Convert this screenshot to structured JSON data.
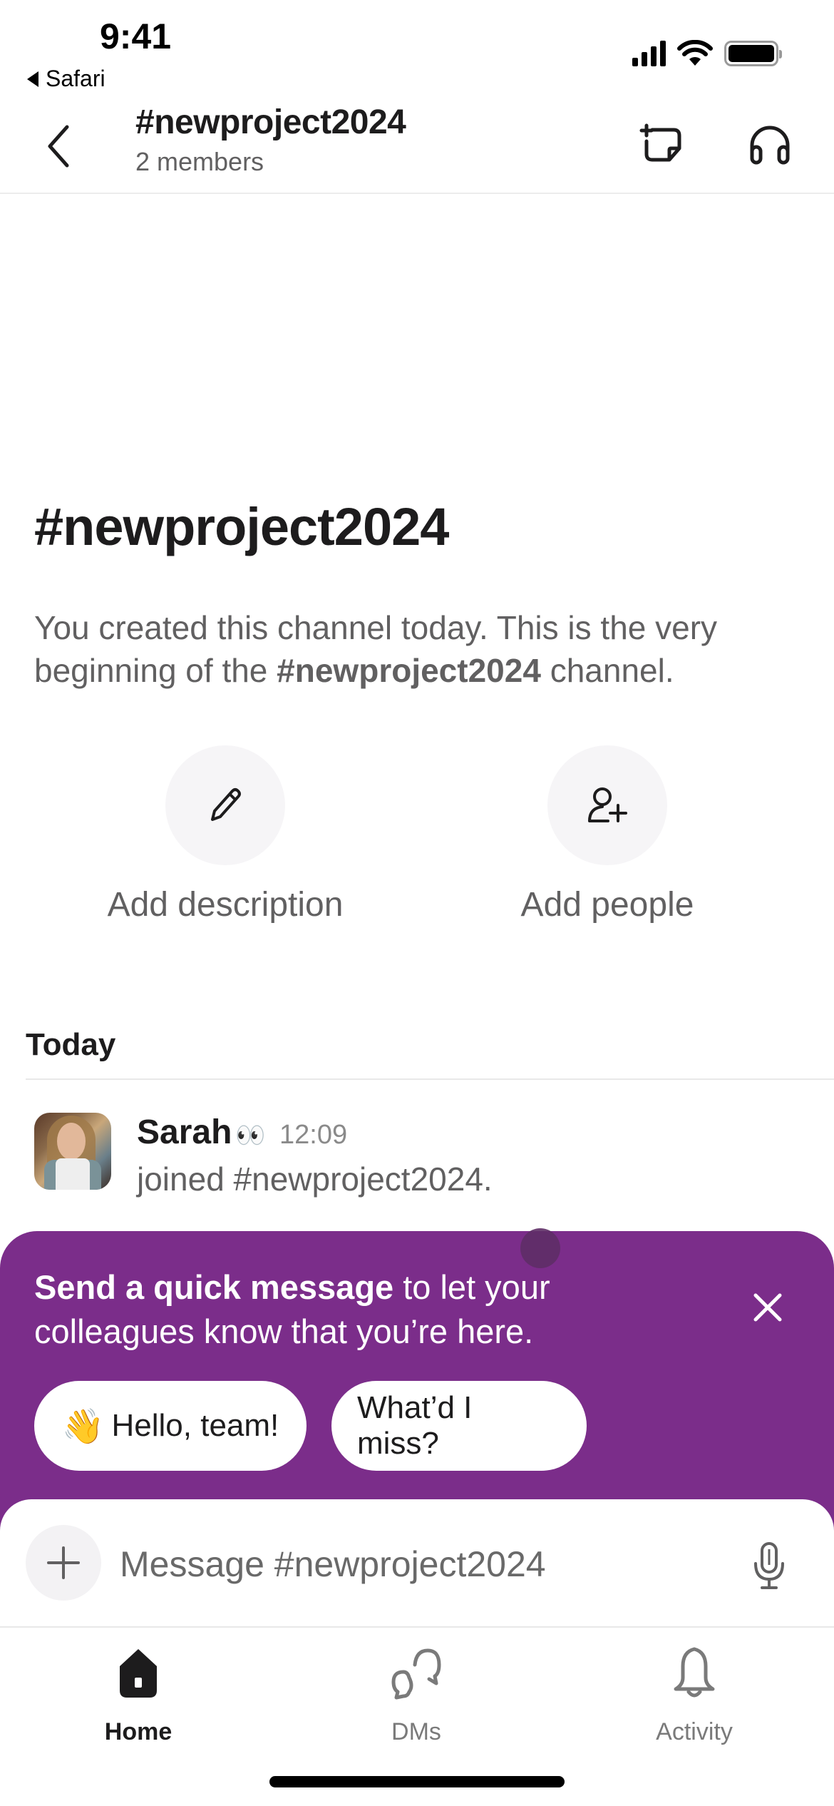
{
  "status_bar": {
    "time": "9:41",
    "back_app": "Safari",
    "icons": [
      "cellular-signal-icon",
      "wifi-icon",
      "battery-icon"
    ]
  },
  "header": {
    "back_icon": "chevron-left-icon",
    "channel_name": "#newproject2024",
    "members": "2 members",
    "actions": [
      {
        "name": "new-canvas",
        "icon": "canvas-add-icon"
      },
      {
        "name": "huddle",
        "icon": "headphones-icon"
      }
    ]
  },
  "intro": {
    "title": "#newproject2024",
    "desc_prefix": "You created this channel today. This is the very beginning of the ",
    "desc_channel": "#newproject2024",
    "desc_suffix": " channel.",
    "actions": [
      {
        "label": "Add description",
        "icon": "pencil-icon"
      },
      {
        "label": "Add people",
        "icon": "add-person-icon"
      }
    ]
  },
  "messages": {
    "day_label": "Today",
    "items": [
      {
        "author": "Sarah",
        "status_emoji": "👀",
        "time": "12:09",
        "text": "joined #newproject2024."
      }
    ]
  },
  "prompt": {
    "bold_text": "Send a quick message",
    "rest_text": " to let your colleagues know that you’re here.",
    "close_icon": "close-icon",
    "background": "#7b2d8a",
    "chips": [
      {
        "emoji": "👋",
        "label": "Hello, team!"
      },
      {
        "emoji": "",
        "label": "What’d I miss?"
      }
    ]
  },
  "composer": {
    "placeholder": "Message #newproject2024",
    "value": "",
    "plus_icon": "plus-icon",
    "mic_icon": "microphone-icon"
  },
  "tabbar": {
    "tabs": [
      {
        "label": "Home",
        "icon": "home-icon",
        "active": true
      },
      {
        "label": "DMs",
        "icon": "dms-icon",
        "active": false
      },
      {
        "label": "Activity",
        "icon": "bell-icon",
        "active": false
      }
    ]
  }
}
